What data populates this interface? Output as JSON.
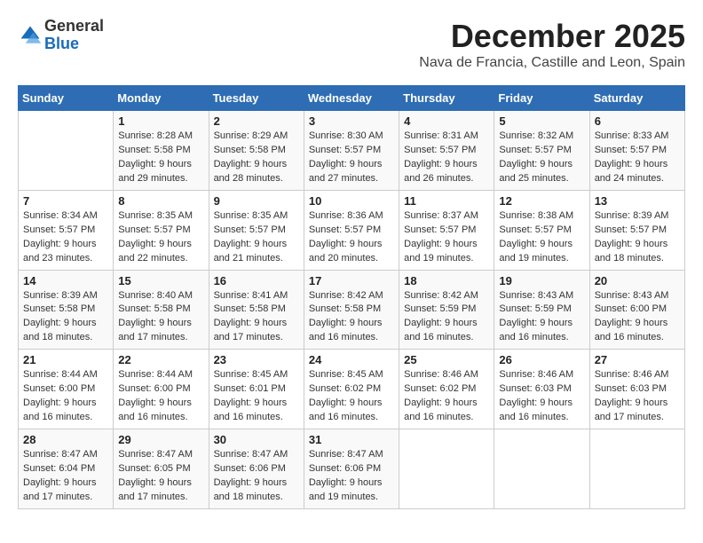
{
  "logo": {
    "general": "General",
    "blue": "Blue"
  },
  "title": "December 2025",
  "subtitle": "Nava de Francia, Castille and Leon, Spain",
  "headers": [
    "Sunday",
    "Monday",
    "Tuesday",
    "Wednesday",
    "Thursday",
    "Friday",
    "Saturday"
  ],
  "weeks": [
    [
      {
        "day": "",
        "sunrise": "",
        "sunset": "",
        "daylight": ""
      },
      {
        "day": "1",
        "sunrise": "Sunrise: 8:28 AM",
        "sunset": "Sunset: 5:58 PM",
        "daylight": "Daylight: 9 hours and 29 minutes."
      },
      {
        "day": "2",
        "sunrise": "Sunrise: 8:29 AM",
        "sunset": "Sunset: 5:58 PM",
        "daylight": "Daylight: 9 hours and 28 minutes."
      },
      {
        "day": "3",
        "sunrise": "Sunrise: 8:30 AM",
        "sunset": "Sunset: 5:57 PM",
        "daylight": "Daylight: 9 hours and 27 minutes."
      },
      {
        "day": "4",
        "sunrise": "Sunrise: 8:31 AM",
        "sunset": "Sunset: 5:57 PM",
        "daylight": "Daylight: 9 hours and 26 minutes."
      },
      {
        "day": "5",
        "sunrise": "Sunrise: 8:32 AM",
        "sunset": "Sunset: 5:57 PM",
        "daylight": "Daylight: 9 hours and 25 minutes."
      },
      {
        "day": "6",
        "sunrise": "Sunrise: 8:33 AM",
        "sunset": "Sunset: 5:57 PM",
        "daylight": "Daylight: 9 hours and 24 minutes."
      }
    ],
    [
      {
        "day": "7",
        "sunrise": "Sunrise: 8:34 AM",
        "sunset": "Sunset: 5:57 PM",
        "daylight": "Daylight: 9 hours and 23 minutes."
      },
      {
        "day": "8",
        "sunrise": "Sunrise: 8:35 AM",
        "sunset": "Sunset: 5:57 PM",
        "daylight": "Daylight: 9 hours and 22 minutes."
      },
      {
        "day": "9",
        "sunrise": "Sunrise: 8:35 AM",
        "sunset": "Sunset: 5:57 PM",
        "daylight": "Daylight: 9 hours and 21 minutes."
      },
      {
        "day": "10",
        "sunrise": "Sunrise: 8:36 AM",
        "sunset": "Sunset: 5:57 PM",
        "daylight": "Daylight: 9 hours and 20 minutes."
      },
      {
        "day": "11",
        "sunrise": "Sunrise: 8:37 AM",
        "sunset": "Sunset: 5:57 PM",
        "daylight": "Daylight: 9 hours and 19 minutes."
      },
      {
        "day": "12",
        "sunrise": "Sunrise: 8:38 AM",
        "sunset": "Sunset: 5:57 PM",
        "daylight": "Daylight: 9 hours and 19 minutes."
      },
      {
        "day": "13",
        "sunrise": "Sunrise: 8:39 AM",
        "sunset": "Sunset: 5:57 PM",
        "daylight": "Daylight: 9 hours and 18 minutes."
      }
    ],
    [
      {
        "day": "14",
        "sunrise": "Sunrise: 8:39 AM",
        "sunset": "Sunset: 5:58 PM",
        "daylight": "Daylight: 9 hours and 18 minutes."
      },
      {
        "day": "15",
        "sunrise": "Sunrise: 8:40 AM",
        "sunset": "Sunset: 5:58 PM",
        "daylight": "Daylight: 9 hours and 17 minutes."
      },
      {
        "day": "16",
        "sunrise": "Sunrise: 8:41 AM",
        "sunset": "Sunset: 5:58 PM",
        "daylight": "Daylight: 9 hours and 17 minutes."
      },
      {
        "day": "17",
        "sunrise": "Sunrise: 8:42 AM",
        "sunset": "Sunset: 5:58 PM",
        "daylight": "Daylight: 9 hours and 16 minutes."
      },
      {
        "day": "18",
        "sunrise": "Sunrise: 8:42 AM",
        "sunset": "Sunset: 5:59 PM",
        "daylight": "Daylight: 9 hours and 16 minutes."
      },
      {
        "day": "19",
        "sunrise": "Sunrise: 8:43 AM",
        "sunset": "Sunset: 5:59 PM",
        "daylight": "Daylight: 9 hours and 16 minutes."
      },
      {
        "day": "20",
        "sunrise": "Sunrise: 8:43 AM",
        "sunset": "Sunset: 6:00 PM",
        "daylight": "Daylight: 9 hours and 16 minutes."
      }
    ],
    [
      {
        "day": "21",
        "sunrise": "Sunrise: 8:44 AM",
        "sunset": "Sunset: 6:00 PM",
        "daylight": "Daylight: 9 hours and 16 minutes."
      },
      {
        "day": "22",
        "sunrise": "Sunrise: 8:44 AM",
        "sunset": "Sunset: 6:00 PM",
        "daylight": "Daylight: 9 hours and 16 minutes."
      },
      {
        "day": "23",
        "sunrise": "Sunrise: 8:45 AM",
        "sunset": "Sunset: 6:01 PM",
        "daylight": "Daylight: 9 hours and 16 minutes."
      },
      {
        "day": "24",
        "sunrise": "Sunrise: 8:45 AM",
        "sunset": "Sunset: 6:02 PM",
        "daylight": "Daylight: 9 hours and 16 minutes."
      },
      {
        "day": "25",
        "sunrise": "Sunrise: 8:46 AM",
        "sunset": "Sunset: 6:02 PM",
        "daylight": "Daylight: 9 hours and 16 minutes."
      },
      {
        "day": "26",
        "sunrise": "Sunrise: 8:46 AM",
        "sunset": "Sunset: 6:03 PM",
        "daylight": "Daylight: 9 hours and 16 minutes."
      },
      {
        "day": "27",
        "sunrise": "Sunrise: 8:46 AM",
        "sunset": "Sunset: 6:03 PM",
        "daylight": "Daylight: 9 hours and 17 minutes."
      }
    ],
    [
      {
        "day": "28",
        "sunrise": "Sunrise: 8:47 AM",
        "sunset": "Sunset: 6:04 PM",
        "daylight": "Daylight: 9 hours and 17 minutes."
      },
      {
        "day": "29",
        "sunrise": "Sunrise: 8:47 AM",
        "sunset": "Sunset: 6:05 PM",
        "daylight": "Daylight: 9 hours and 17 minutes."
      },
      {
        "day": "30",
        "sunrise": "Sunrise: 8:47 AM",
        "sunset": "Sunset: 6:06 PM",
        "daylight": "Daylight: 9 hours and 18 minutes."
      },
      {
        "day": "31",
        "sunrise": "Sunrise: 8:47 AM",
        "sunset": "Sunset: 6:06 PM",
        "daylight": "Daylight: 9 hours and 19 minutes."
      },
      {
        "day": "",
        "sunrise": "",
        "sunset": "",
        "daylight": ""
      },
      {
        "day": "",
        "sunrise": "",
        "sunset": "",
        "daylight": ""
      },
      {
        "day": "",
        "sunrise": "",
        "sunset": "",
        "daylight": ""
      }
    ]
  ]
}
